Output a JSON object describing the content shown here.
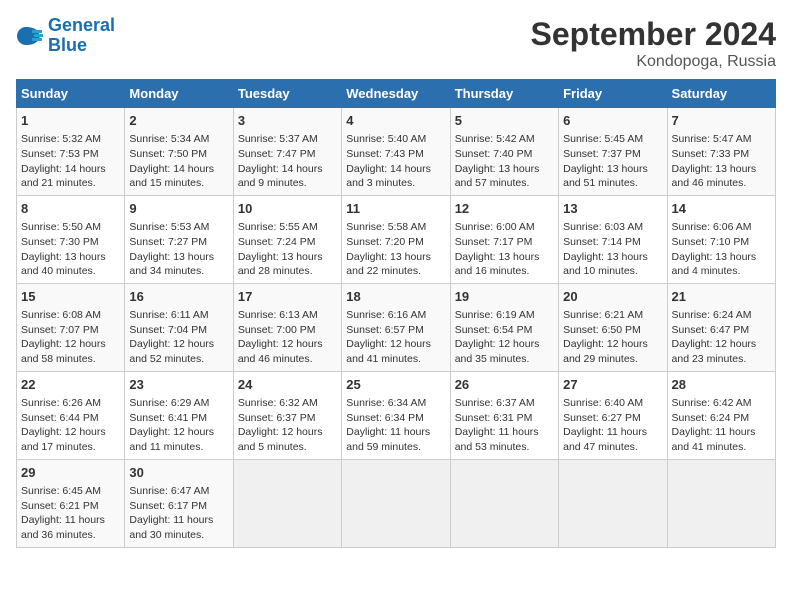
{
  "header": {
    "logo_line1": "General",
    "logo_line2": "Blue",
    "month": "September 2024",
    "location": "Kondopoga, Russia"
  },
  "days_of_week": [
    "Sunday",
    "Monday",
    "Tuesday",
    "Wednesday",
    "Thursday",
    "Friday",
    "Saturday"
  ],
  "weeks": [
    [
      {
        "day": "1",
        "sunrise": "Sunrise: 5:32 AM",
        "sunset": "Sunset: 7:53 PM",
        "daylight": "Daylight: 14 hours and 21 minutes."
      },
      {
        "day": "2",
        "sunrise": "Sunrise: 5:34 AM",
        "sunset": "Sunset: 7:50 PM",
        "daylight": "Daylight: 14 hours and 15 minutes."
      },
      {
        "day": "3",
        "sunrise": "Sunrise: 5:37 AM",
        "sunset": "Sunset: 7:47 PM",
        "daylight": "Daylight: 14 hours and 9 minutes."
      },
      {
        "day": "4",
        "sunrise": "Sunrise: 5:40 AM",
        "sunset": "Sunset: 7:43 PM",
        "daylight": "Daylight: 14 hours and 3 minutes."
      },
      {
        "day": "5",
        "sunrise": "Sunrise: 5:42 AM",
        "sunset": "Sunset: 7:40 PM",
        "daylight": "Daylight: 13 hours and 57 minutes."
      },
      {
        "day": "6",
        "sunrise": "Sunrise: 5:45 AM",
        "sunset": "Sunset: 7:37 PM",
        "daylight": "Daylight: 13 hours and 51 minutes."
      },
      {
        "day": "7",
        "sunrise": "Sunrise: 5:47 AM",
        "sunset": "Sunset: 7:33 PM",
        "daylight": "Daylight: 13 hours and 46 minutes."
      }
    ],
    [
      {
        "day": "8",
        "sunrise": "Sunrise: 5:50 AM",
        "sunset": "Sunset: 7:30 PM",
        "daylight": "Daylight: 13 hours and 40 minutes."
      },
      {
        "day": "9",
        "sunrise": "Sunrise: 5:53 AM",
        "sunset": "Sunset: 7:27 PM",
        "daylight": "Daylight: 13 hours and 34 minutes."
      },
      {
        "day": "10",
        "sunrise": "Sunrise: 5:55 AM",
        "sunset": "Sunset: 7:24 PM",
        "daylight": "Daylight: 13 hours and 28 minutes."
      },
      {
        "day": "11",
        "sunrise": "Sunrise: 5:58 AM",
        "sunset": "Sunset: 7:20 PM",
        "daylight": "Daylight: 13 hours and 22 minutes."
      },
      {
        "day": "12",
        "sunrise": "Sunrise: 6:00 AM",
        "sunset": "Sunset: 7:17 PM",
        "daylight": "Daylight: 13 hours and 16 minutes."
      },
      {
        "day": "13",
        "sunrise": "Sunrise: 6:03 AM",
        "sunset": "Sunset: 7:14 PM",
        "daylight": "Daylight: 13 hours and 10 minutes."
      },
      {
        "day": "14",
        "sunrise": "Sunrise: 6:06 AM",
        "sunset": "Sunset: 7:10 PM",
        "daylight": "Daylight: 13 hours and 4 minutes."
      }
    ],
    [
      {
        "day": "15",
        "sunrise": "Sunrise: 6:08 AM",
        "sunset": "Sunset: 7:07 PM",
        "daylight": "Daylight: 12 hours and 58 minutes."
      },
      {
        "day": "16",
        "sunrise": "Sunrise: 6:11 AM",
        "sunset": "Sunset: 7:04 PM",
        "daylight": "Daylight: 12 hours and 52 minutes."
      },
      {
        "day": "17",
        "sunrise": "Sunrise: 6:13 AM",
        "sunset": "Sunset: 7:00 PM",
        "daylight": "Daylight: 12 hours and 46 minutes."
      },
      {
        "day": "18",
        "sunrise": "Sunrise: 6:16 AM",
        "sunset": "Sunset: 6:57 PM",
        "daylight": "Daylight: 12 hours and 41 minutes."
      },
      {
        "day": "19",
        "sunrise": "Sunrise: 6:19 AM",
        "sunset": "Sunset: 6:54 PM",
        "daylight": "Daylight: 12 hours and 35 minutes."
      },
      {
        "day": "20",
        "sunrise": "Sunrise: 6:21 AM",
        "sunset": "Sunset: 6:50 PM",
        "daylight": "Daylight: 12 hours and 29 minutes."
      },
      {
        "day": "21",
        "sunrise": "Sunrise: 6:24 AM",
        "sunset": "Sunset: 6:47 PM",
        "daylight": "Daylight: 12 hours and 23 minutes."
      }
    ],
    [
      {
        "day": "22",
        "sunrise": "Sunrise: 6:26 AM",
        "sunset": "Sunset: 6:44 PM",
        "daylight": "Daylight: 12 hours and 17 minutes."
      },
      {
        "day": "23",
        "sunrise": "Sunrise: 6:29 AM",
        "sunset": "Sunset: 6:41 PM",
        "daylight": "Daylight: 12 hours and 11 minutes."
      },
      {
        "day": "24",
        "sunrise": "Sunrise: 6:32 AM",
        "sunset": "Sunset: 6:37 PM",
        "daylight": "Daylight: 12 hours and 5 minutes."
      },
      {
        "day": "25",
        "sunrise": "Sunrise: 6:34 AM",
        "sunset": "Sunset: 6:34 PM",
        "daylight": "Daylight: 11 hours and 59 minutes."
      },
      {
        "day": "26",
        "sunrise": "Sunrise: 6:37 AM",
        "sunset": "Sunset: 6:31 PM",
        "daylight": "Daylight: 11 hours and 53 minutes."
      },
      {
        "day": "27",
        "sunrise": "Sunrise: 6:40 AM",
        "sunset": "Sunset: 6:27 PM",
        "daylight": "Daylight: 11 hours and 47 minutes."
      },
      {
        "day": "28",
        "sunrise": "Sunrise: 6:42 AM",
        "sunset": "Sunset: 6:24 PM",
        "daylight": "Daylight: 11 hours and 41 minutes."
      }
    ],
    [
      {
        "day": "29",
        "sunrise": "Sunrise: 6:45 AM",
        "sunset": "Sunset: 6:21 PM",
        "daylight": "Daylight: 11 hours and 36 minutes."
      },
      {
        "day": "30",
        "sunrise": "Sunrise: 6:47 AM",
        "sunset": "Sunset: 6:17 PM",
        "daylight": "Daylight: 11 hours and 30 minutes."
      },
      {
        "day": "",
        "sunrise": "",
        "sunset": "",
        "daylight": ""
      },
      {
        "day": "",
        "sunrise": "",
        "sunset": "",
        "daylight": ""
      },
      {
        "day": "",
        "sunrise": "",
        "sunset": "",
        "daylight": ""
      },
      {
        "day": "",
        "sunrise": "",
        "sunset": "",
        "daylight": ""
      },
      {
        "day": "",
        "sunrise": "",
        "sunset": "",
        "daylight": ""
      }
    ]
  ]
}
